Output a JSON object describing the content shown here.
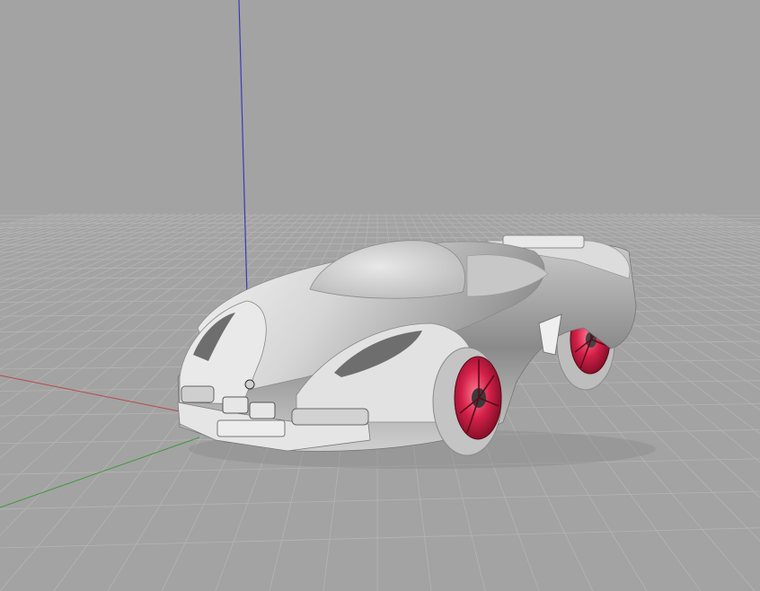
{
  "viewport": {
    "projection": "perspective",
    "background_color": "#a3a3a3",
    "grid_color": "#b4b4b4",
    "axes": [
      {
        "axis": "x",
        "color": "#b84a4a"
      },
      {
        "axis": "y",
        "color": "#3c9a3c"
      },
      {
        "axis": "z",
        "color": "#3a3ab8"
      }
    ]
  },
  "model": {
    "object": "sports-car",
    "body_color": "#d9d9d9",
    "wheel_rim_color": "#c81e3c",
    "tire_color": "#c4c4c4"
  }
}
